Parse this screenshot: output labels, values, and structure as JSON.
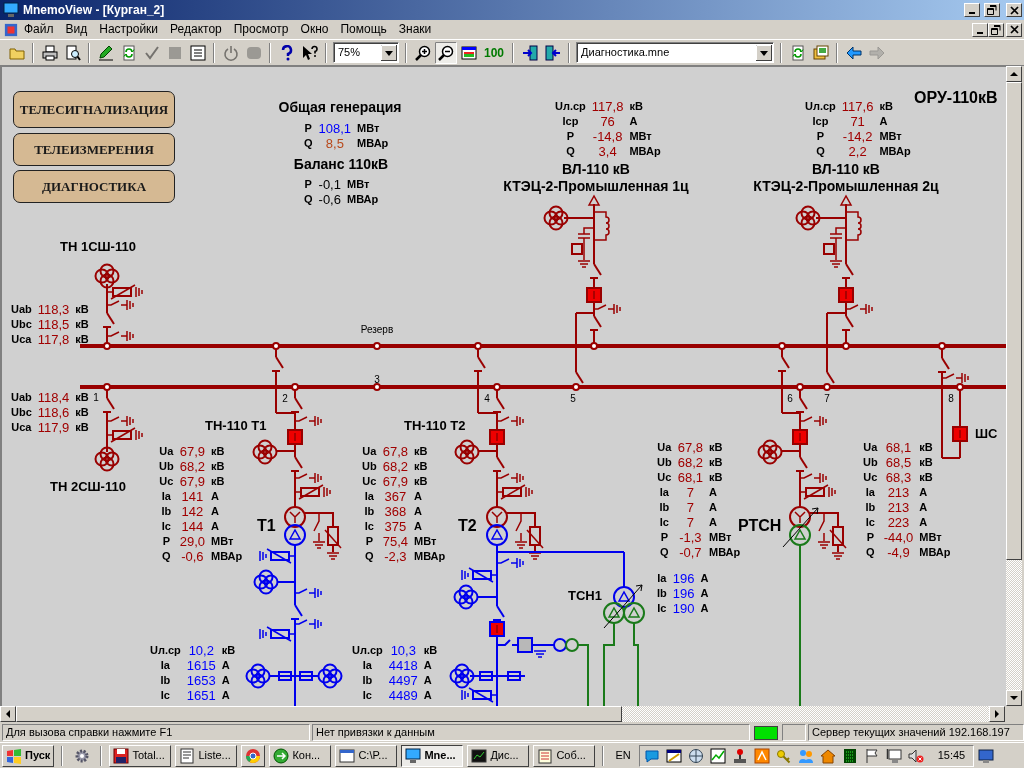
{
  "window": {
    "title": "MnemoView - [Курган_2]"
  },
  "menu": [
    "Файл",
    "Вид",
    "Настройки",
    "Редактор",
    "Просмотр",
    "Окно",
    "Помощь",
    "Знаки"
  ],
  "toolbar": [
    [
      {
        "kind": "open",
        "disabled": false,
        "pressed": false
      }
    ],
    [
      {
        "kind": "print",
        "disabled": false,
        "pressed": false
      },
      {
        "kind": "preview",
        "disabled": false,
        "pressed": false
      }
    ],
    [
      {
        "kind": "edit",
        "disabled": false,
        "pressed": false
      },
      {
        "kind": "refresh",
        "disabled": false,
        "pressed": false
      },
      {
        "kind": "check",
        "disabled": true,
        "pressed": false
      },
      {
        "kind": "stop",
        "disabled": true,
        "pressed": false
      },
      {
        "kind": "list",
        "disabled": false,
        "pressed": false
      }
    ],
    [
      {
        "kind": "power",
        "disabled": true,
        "pressed": false
      },
      {
        "kind": "record",
        "disabled": true,
        "pressed": false
      }
    ],
    [
      {
        "kind": "help",
        "disabled": false,
        "pressed": false
      },
      {
        "kind": "contexthelp",
        "disabled": false,
        "pressed": false
      }
    ],
    [
      {
        "kind": "combo",
        "value": "75%",
        "disabled": false
      }
    ],
    [
      {
        "kind": "zoomin",
        "disabled": false,
        "pressed": false
      },
      {
        "kind": "zoomout",
        "disabled": false,
        "pressed": true
      },
      {
        "kind": "fit",
        "disabled": false,
        "pressed": false
      },
      {
        "kind": "text",
        "label": "100",
        "disabled": false,
        "pressed": false
      }
    ],
    [
      {
        "kind": "export",
        "disabled": false,
        "pressed": false
      },
      {
        "kind": "import",
        "disabled": false,
        "pressed": false
      }
    ],
    [
      {
        "kind": "combo",
        "value": "Диагностика.mne",
        "disabled": false
      }
    ],
    [
      {
        "kind": "reload",
        "disabled": false,
        "pressed": false
      },
      {
        "kind": "gallery",
        "disabled": false,
        "pressed": false
      }
    ],
    [
      {
        "kind": "back",
        "disabled": false,
        "pressed": false
      },
      {
        "kind": "forward",
        "disabled": true,
        "pressed": false
      }
    ]
  ],
  "nav_buttons": [
    "ТЕЛЕСИГНАЛИЗАЦИЯ",
    "ТЕЛЕИЗМЕРЕНИЯ",
    "ДИАГНОСТИКА"
  ],
  "generation": {
    "title": "Общая генерация",
    "rows": [
      {
        "name": "P",
        "value": "108,1",
        "unit": "МВт",
        "color": "#0000ff"
      },
      {
        "name": "Q",
        "value": "8,5",
        "unit": "МВАр",
        "color": "#b8481a"
      }
    ]
  },
  "balance": {
    "title": "Баланс 110кВ",
    "rows": [
      {
        "name": "P",
        "value": "-0,1",
        "unit": "МВт"
      },
      {
        "name": "Q",
        "value": "-0,6",
        "unit": "МВАр"
      }
    ]
  },
  "labels": [
    {
      "kind": "heading",
      "text": "ОРУ-110кВ"
    },
    {
      "kind": "title",
      "text": "ВЛ-110 кВ"
    },
    {
      "kind": "title",
      "text": "КТЭЦ-2-Промышленная 1ц"
    },
    {
      "kind": "title",
      "text": "ВЛ-110 кВ"
    },
    {
      "kind": "title",
      "text": "КТЭЦ-2-Промышленная 2ц"
    },
    {
      "kind": "name",
      "text": "ТН 1СШ-110"
    },
    {
      "kind": "note",
      "text": "Резерв"
    },
    {
      "kind": "number",
      "text": "3"
    },
    {
      "kind": "number",
      "text": "1"
    },
    {
      "kind": "number",
      "text": "2"
    },
    {
      "kind": "number",
      "text": "4"
    },
    {
      "kind": "number",
      "text": "5"
    },
    {
      "kind": "number",
      "text": "6"
    },
    {
      "kind": "number",
      "text": "7"
    },
    {
      "kind": "number",
      "text": "8"
    },
    {
      "kind": "name",
      "text": "ТН-110 Т1"
    },
    {
      "kind": "name",
      "text": "ТН-110 Т2"
    },
    {
      "kind": "name",
      "text": "ШС"
    },
    {
      "kind": "name",
      "text": "ТН 2СШ-110"
    },
    {
      "kind": "heading",
      "text": "Т1"
    },
    {
      "kind": "heading",
      "text": "Т2"
    },
    {
      "kind": "heading",
      "text": "РТСН"
    },
    {
      "kind": "name",
      "text": "ТСН1"
    }
  ],
  "blocks": [
    {
      "color": "#a00000",
      "rows": [
        {
          "name": "Uab",
          "value": "118,3",
          "unit": "кВ"
        },
        {
          "name": "Ubc",
          "value": "118,5",
          "unit": "кВ"
        },
        {
          "name": "Uca",
          "value": "117,8",
          "unit": "кВ"
        }
      ]
    },
    {
      "color": "#a00000",
      "rows": [
        {
          "name": "Uab",
          "value": "118,4",
          "unit": "кВ"
        },
        {
          "name": "Ubc",
          "value": "118,6",
          "unit": "кВ"
        },
        {
          "name": "Uca",
          "value": "117,9",
          "unit": "кВ"
        }
      ]
    },
    {
      "color": "#a00000",
      "rows": [
        {
          "name": "Uл.ср",
          "value": "117,8",
          "unit": "кВ"
        },
        {
          "name": "Iср",
          "value": "76",
          "unit": "А"
        },
        {
          "name": "P",
          "value": "-14,8",
          "unit": "МВт"
        },
        {
          "name": "Q",
          "value": "3,4",
          "unit": "МВАр"
        }
      ]
    },
    {
      "color": "#a00000",
      "rows": [
        {
          "name": "Uл.ср",
          "value": "117,6",
          "unit": "кВ"
        },
        {
          "name": "Iср",
          "value": "71",
          "unit": "А"
        },
        {
          "name": "P",
          "value": "-14,2",
          "unit": "МВт"
        },
        {
          "name": "Q",
          "value": "2,2",
          "unit": "МВАр"
        }
      ]
    },
    {
      "color": "#a00000",
      "rows": [
        {
          "name": "Ua",
          "value": "67,9",
          "unit": "кВ"
        },
        {
          "name": "Ub",
          "value": "68,2",
          "unit": "кВ"
        },
        {
          "name": "Uc",
          "value": "67,9",
          "unit": "кВ"
        },
        {
          "name": "Ia",
          "value": "141",
          "unit": "А"
        },
        {
          "name": "Ib",
          "value": "142",
          "unit": "А"
        },
        {
          "name": "Ic",
          "value": "144",
          "unit": "А"
        },
        {
          "name": "P",
          "value": "29,0",
          "unit": "МВт"
        },
        {
          "name": "Q",
          "value": "-0,6",
          "unit": "МВАр"
        }
      ]
    },
    {
      "color": "#a00000",
      "rows": [
        {
          "name": "Ua",
          "value": "67,8",
          "unit": "кВ"
        },
        {
          "name": "Ub",
          "value": "68,2",
          "unit": "кВ"
        },
        {
          "name": "Uc",
          "value": "67,9",
          "unit": "кВ"
        },
        {
          "name": "Ia",
          "value": "367",
          "unit": "А"
        },
        {
          "name": "Ib",
          "value": "368",
          "unit": "А"
        },
        {
          "name": "Ic",
          "value": "375",
          "unit": "А"
        },
        {
          "name": "P",
          "value": "75,4",
          "unit": "МВт"
        },
        {
          "name": "Q",
          "value": "-2,3",
          "unit": "МВАр"
        }
      ]
    },
    {
      "color": "#a00000",
      "rows": [
        {
          "name": "Ua",
          "value": "67,8",
          "unit": "кВ"
        },
        {
          "name": "Ub",
          "value": "68,2",
          "unit": "кВ"
        },
        {
          "name": "Uc",
          "value": "68,1",
          "unit": "кВ"
        },
        {
          "name": "Ia",
          "value": "7",
          "unit": "А"
        },
        {
          "name": "Ib",
          "value": "7",
          "unit": "А"
        },
        {
          "name": "Ic",
          "value": "7",
          "unit": "А"
        },
        {
          "name": "P",
          "value": "-1,3",
          "unit": "МВт"
        },
        {
          "name": "Q",
          "value": "-0,7",
          "unit": "МВАр"
        }
      ]
    },
    {
      "color": "#0000ff",
      "rows": [
        {
          "name": "Ia",
          "value": "196",
          "unit": "А"
        },
        {
          "name": "Ib",
          "value": "196",
          "unit": "А"
        },
        {
          "name": "Ic",
          "value": "190",
          "unit": "А"
        }
      ]
    },
    {
      "color": "#a00000",
      "rows": [
        {
          "name": "Ua",
          "value": "68,1",
          "unit": "кВ"
        },
        {
          "name": "Ub",
          "value": "68,5",
          "unit": "кВ"
        },
        {
          "name": "Uc",
          "value": "68,3",
          "unit": "кВ"
        },
        {
          "name": "Ia",
          "value": "213",
          "unit": "А"
        },
        {
          "name": "Ib",
          "value": "213",
          "unit": "А"
        },
        {
          "name": "Ic",
          "value": "223",
          "unit": "А"
        },
        {
          "name": "P",
          "value": "-44,0",
          "unit": "МВт"
        },
        {
          "name": "Q",
          "value": "-4,9",
          "unit": "МВАр"
        }
      ]
    },
    {
      "color": "#0000ff",
      "rows": [
        {
          "name": "Uл.ср",
          "value": "10,2",
          "unit": "кВ"
        },
        {
          "name": "Ia",
          "value": "1615",
          "unit": "А"
        },
        {
          "name": "Ib",
          "value": "1653",
          "unit": "А"
        },
        {
          "name": "Ic",
          "value": "1651",
          "unit": "А"
        }
      ]
    },
    {
      "color": "#0000ff",
      "rows": [
        {
          "name": "Uл.ср",
          "value": "10,3",
          "unit": "кВ"
        },
        {
          "name": "Ia",
          "value": "4418",
          "unit": "А"
        },
        {
          "name": "Ib",
          "value": "4497",
          "unit": "А"
        },
        {
          "name": "Ic",
          "value": "4489",
          "unit": "А"
        }
      ]
    }
  ],
  "status_bar": [
    "Для вызова справки нажмите F1",
    "Нет привязки к данным",
    "Сервер текущих значений 192.168.197"
  ],
  "taskbar": {
    "start": "Пуск",
    "tasks": [
      {
        "label": "Total...",
        "selected": false
      },
      {
        "label": "Liste...",
        "selected": false
      },
      {
        "selected": false
      },
      {
        "label": "Кон...",
        "selected": false
      },
      {
        "label": "C:\\P...",
        "selected": false
      },
      {
        "label": "Mne...",
        "selected": true
      },
      {
        "label": "Дис...",
        "selected": false
      },
      {
        "label": "Соб...",
        "selected": false
      }
    ],
    "language": "EN",
    "clock": "15:45"
  }
}
